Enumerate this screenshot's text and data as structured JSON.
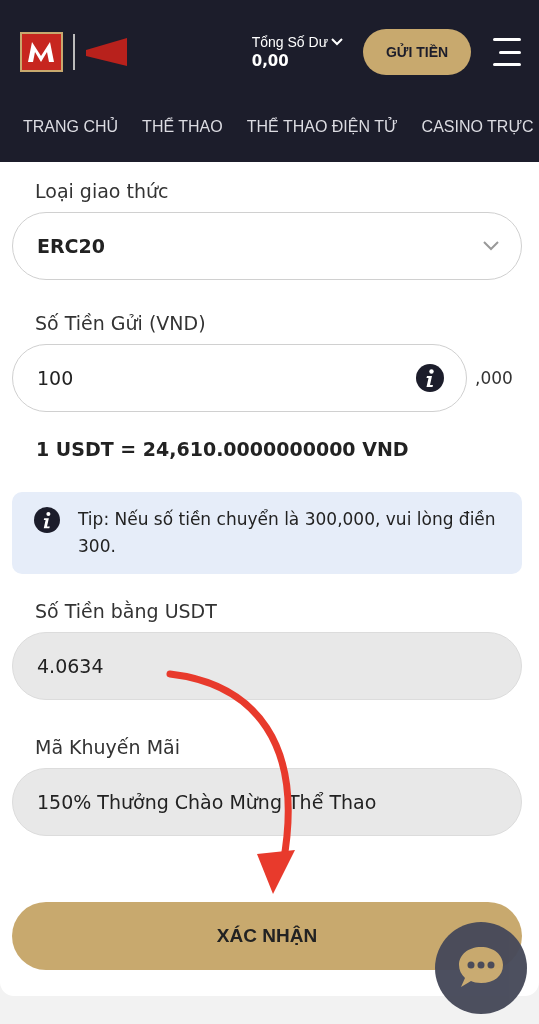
{
  "header": {
    "balance_label": "Tổng Số Dư",
    "balance": "0,00",
    "deposit_button": "GỬI TIỀN"
  },
  "nav": [
    {
      "label": "TRANG CHỦ",
      "selected": false
    },
    {
      "label": "THỂ THAO",
      "selected": false
    },
    {
      "label": "THỂ THAO ĐIỆN TỬ",
      "selected": false
    },
    {
      "label": "CASINO TRỰC",
      "selected": false
    }
  ],
  "form": {
    "protocol_label": "Loại giao thức",
    "protocol_value": "ERC20",
    "amount_label": "Số Tiền Gửi (VND)",
    "amount_value": "100",
    "amount_suffix": ",000",
    "rate": "1 USDT = 24,610.0000000000 VND",
    "tip": "Tip: Nếu số tiền chuyển là 300,000, vui lòng điền 300.",
    "usdt_label": "Số Tiền bằng USDT",
    "usdt_value": "4.0634",
    "promo_label": "Mã Khuyến Mãi",
    "promo_value": "150% Thưởng Chào Mừng Thể Thao",
    "submit": "XÁC NHẬN"
  }
}
